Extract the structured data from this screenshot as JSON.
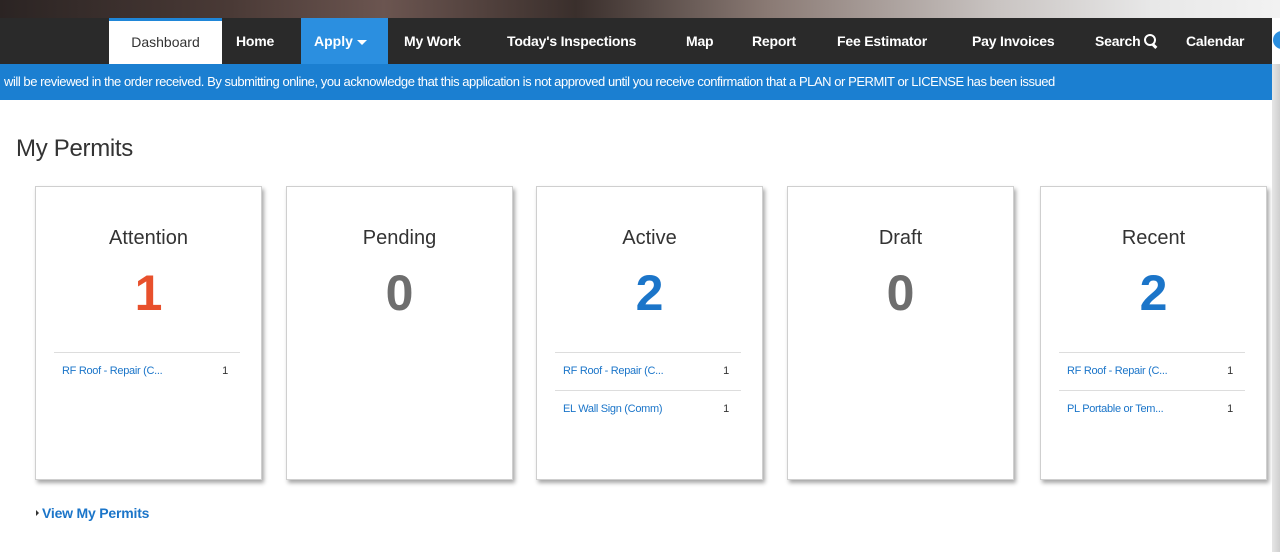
{
  "nav": {
    "dashboard": "Dashboard",
    "home": "Home",
    "apply": "Apply",
    "my_work": "My Work",
    "inspections": "Today's Inspections",
    "map": "Map",
    "report": "Report",
    "fee_estimator": "Fee Estimator",
    "pay_invoices": "Pay Invoices",
    "search": "Search",
    "calendar": "Calendar"
  },
  "notice": "will be reviewed in the order received. By submitting online, you acknowledge that this application is not approved until you receive confirmation that a PLAN or PERMIT or LICENSE has been issued",
  "page_title": "My Permits",
  "cards": [
    {
      "title": "Attention",
      "count": "1",
      "rows": [
        {
          "label": "RF Roof - Repair (C...",
          "count": "1"
        }
      ]
    },
    {
      "title": "Pending",
      "count": "0",
      "rows": []
    },
    {
      "title": "Active",
      "count": "2",
      "rows": [
        {
          "label": "RF Roof - Repair (C...",
          "count": "1"
        },
        {
          "label": "EL Wall Sign (Comm)",
          "count": "1"
        }
      ]
    },
    {
      "title": "Draft",
      "count": "0",
      "rows": []
    },
    {
      "title": "Recent",
      "count": "2",
      "rows": [
        {
          "label": "RF Roof - Repair (C...",
          "count": "1"
        },
        {
          "label": "PL Portable or Tem...",
          "count": "1"
        }
      ]
    }
  ],
  "view_link": "View My Permits",
  "colors": {
    "attention": "#e8502c",
    "zero": "#6e6e6e",
    "active": "#1b75c9",
    "nav_bg": "#2a2a2a",
    "notice_bg": "#1b7fd1"
  }
}
